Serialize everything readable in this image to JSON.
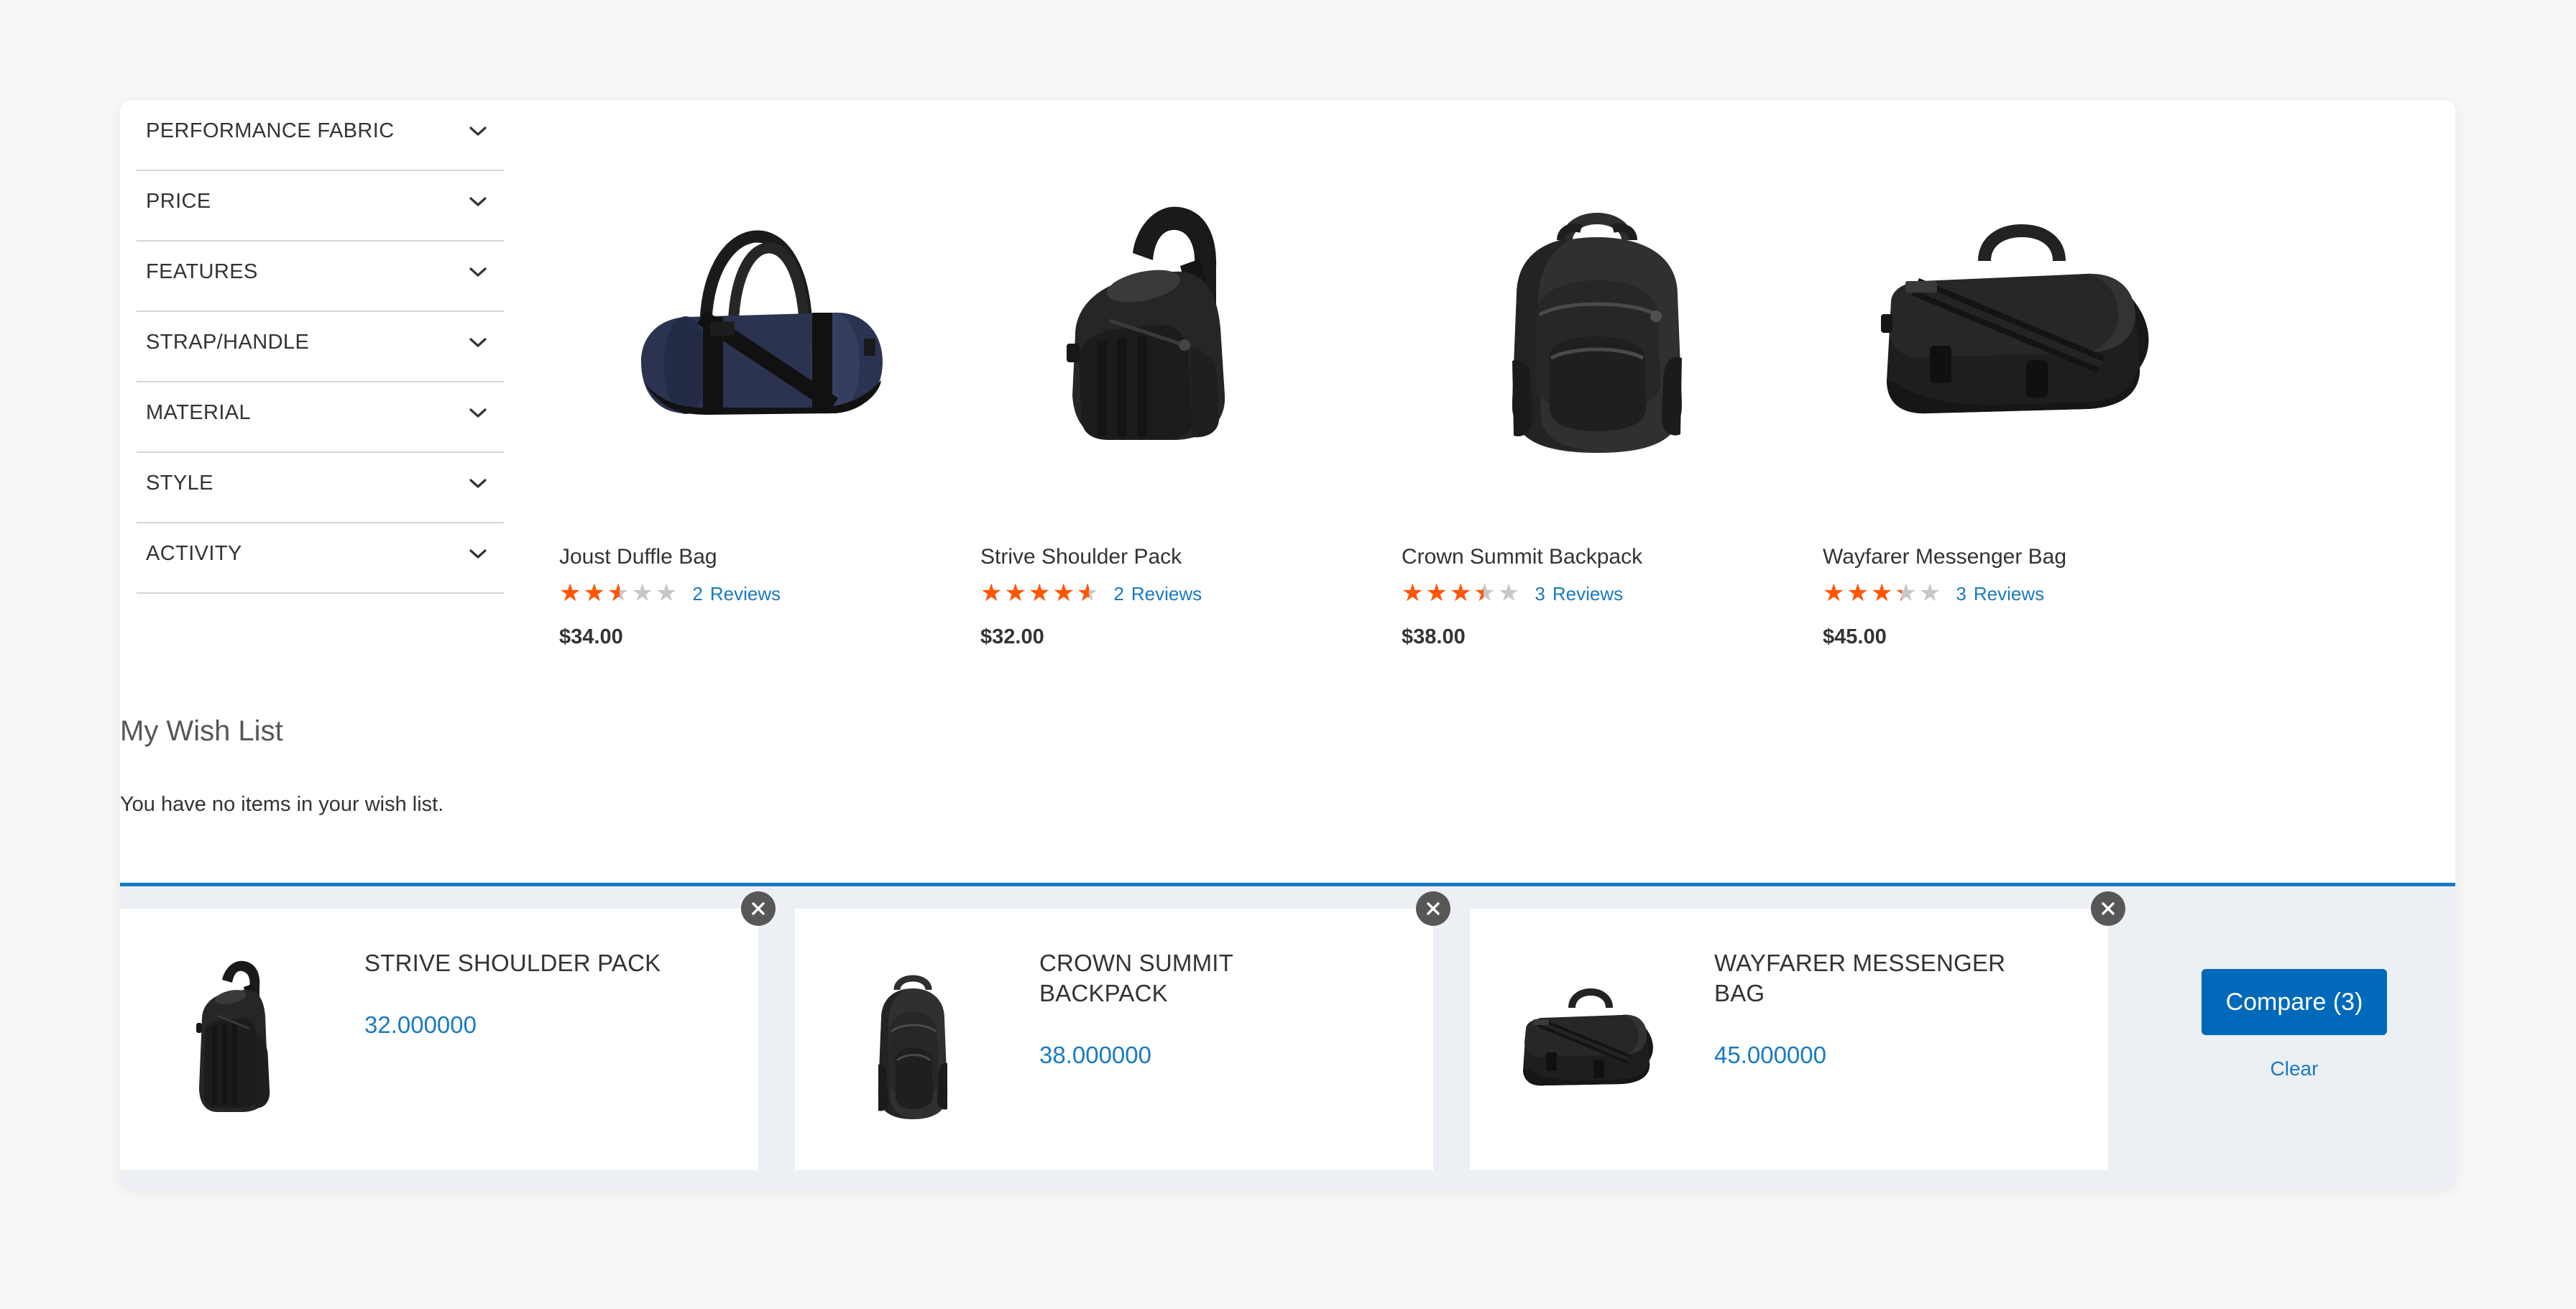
{
  "sidebar": {
    "filters": [
      {
        "label": "PERFORMANCE FABRIC",
        "icon": "chevron-down-icon"
      },
      {
        "label": "PRICE",
        "icon": "chevron-down-icon"
      },
      {
        "label": "FEATURES",
        "icon": "chevron-down-icon"
      },
      {
        "label": "STRAP/HANDLE",
        "icon": "chevron-down-icon"
      },
      {
        "label": "MATERIAL",
        "icon": "chevron-down-icon"
      },
      {
        "label": "STYLE",
        "icon": "chevron-down-icon"
      },
      {
        "label": "ACTIVITY",
        "icon": "chevron-down-icon"
      }
    ],
    "wishlist": {
      "title": "My Wish List",
      "empty_text": "You have no items in your wish list."
    }
  },
  "products": [
    {
      "name": "Joust Duffle Bag",
      "rating_percent": 50,
      "review_count": "2",
      "reviews_label": "Reviews",
      "price": "$34.00",
      "image": "duffle-bag-navy"
    },
    {
      "name": "Strive Shoulder Pack",
      "rating_percent": 90,
      "review_count": "2",
      "reviews_label": "Reviews",
      "price": "$32.00",
      "image": "sling-backpack-black"
    },
    {
      "name": "Crown Summit Backpack",
      "rating_percent": 68,
      "review_count": "3",
      "reviews_label": "Reviews",
      "price": "$38.00",
      "image": "backpack-black"
    },
    {
      "name": "Wayfarer Messenger Bag",
      "rating_percent": 66,
      "review_count": "3",
      "reviews_label": "Reviews",
      "price": "$45.00",
      "image": "messenger-bag-black"
    }
  ],
  "compare_bar": {
    "items": [
      {
        "name": "STRIVE SHOULDER PACK",
        "price": "32.000000",
        "image": "sling-backpack-black",
        "close_icon": "close-icon"
      },
      {
        "name": "CROWN SUMMIT BACKPACK",
        "price": "38.000000",
        "image": "backpack-black",
        "close_icon": "close-icon"
      },
      {
        "name": "WAYFARER MESSENGER BAG",
        "price": "45.000000",
        "image": "messenger-bag-black",
        "close_icon": "close-icon"
      }
    ],
    "compare_button_label": "Compare (3)",
    "clear_link_label": "Clear"
  },
  "colors": {
    "accent_blue": "#1979c3",
    "button_blue": "#0069ba",
    "star_orange": "#ff5501",
    "star_grey": "#c7c7c7",
    "compare_bg": "#eceff3",
    "page_bg": "#f7f7f7"
  }
}
